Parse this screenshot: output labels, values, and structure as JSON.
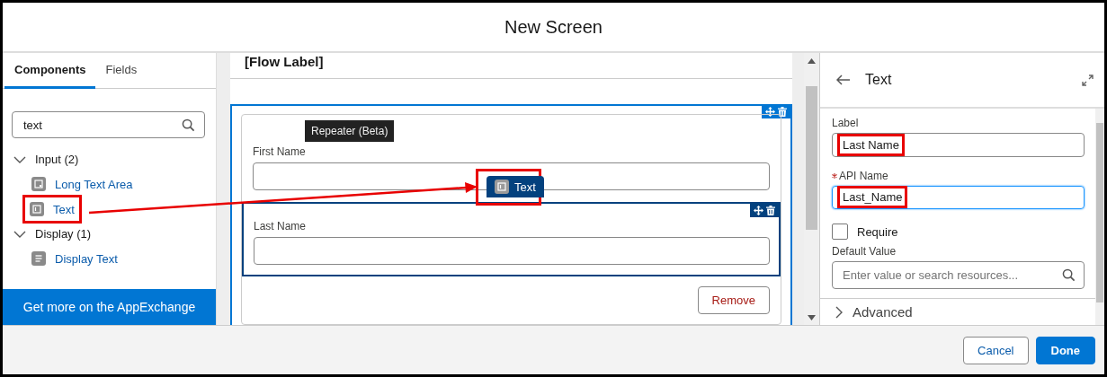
{
  "window": {
    "title": "New Screen"
  },
  "palette": {
    "tabs": [
      {
        "label": "Components",
        "selected": true
      },
      {
        "label": "Fields",
        "selected": false
      }
    ],
    "search": {
      "value": "text"
    },
    "groups": [
      {
        "label": "Input (2)",
        "expanded": true,
        "children": [
          {
            "label": "Long Text Area",
            "kind": "textarea",
            "annotated": false
          },
          {
            "label": "Text",
            "kind": "text",
            "annotated": true
          }
        ]
      },
      {
        "label": "Display (1)",
        "expanded": true,
        "children": [
          {
            "label": "Display Text",
            "kind": "display",
            "annotated": false
          }
        ]
      }
    ],
    "appexchange_button": "Get more on the AppExchange"
  },
  "canvas": {
    "title": "[Flow Label]",
    "repeater_tooltip": "Repeater (Beta)",
    "fields": [
      {
        "label": "First Name",
        "selected": false
      },
      {
        "label": "Last Name",
        "selected": true
      }
    ],
    "drag_chip": {
      "label": "Text",
      "annotated": true
    },
    "remove_button": "Remove"
  },
  "properties": {
    "title": "Text",
    "fields": [
      {
        "kind": "text",
        "label": "Label",
        "value": "Last Name",
        "required": false,
        "focused": false,
        "annotated": true
      },
      {
        "kind": "text",
        "label": "API Name",
        "value": "Last_Name",
        "required": true,
        "focused": true,
        "annotated": true
      },
      {
        "kind": "checkbox",
        "label": "Require",
        "checked": false
      },
      {
        "kind": "search",
        "label": "Default Value",
        "placeholder": "Enter value or search resources..."
      }
    ],
    "section": {
      "label": "Advanced",
      "expanded": false
    }
  },
  "footer": {
    "buttons": [
      {
        "label": "Cancel",
        "kind": "neutral"
      },
      {
        "label": "Done",
        "kind": "brand"
      }
    ]
  }
}
